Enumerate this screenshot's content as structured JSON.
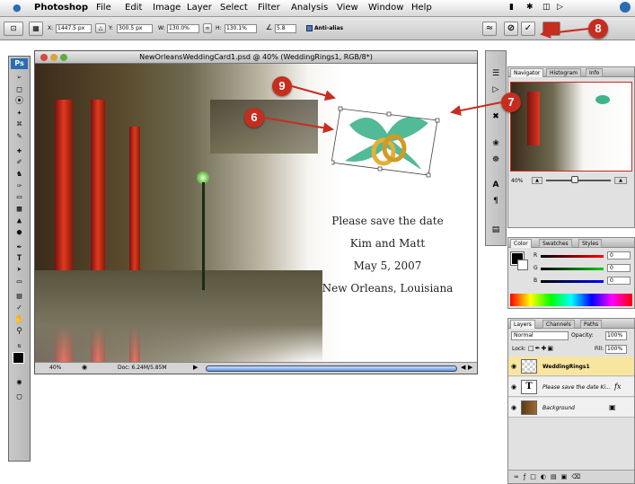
{
  "menubar": {
    "apple_icon": "apple-icon",
    "app": "Photoshop",
    "items": [
      "File",
      "Edit",
      "Image",
      "Layer",
      "Select",
      "Filter",
      "Analysis",
      "View",
      "Window",
      "Help"
    ]
  },
  "options": {
    "x_label": "X:",
    "x_value": "1447.5 px",
    "y_label": "Y:",
    "y_value": "300.5 px",
    "w_label": "W:",
    "w_value": "130.0%",
    "h_label": "H:",
    "h_value": "130.1%",
    "angle_label": "∠",
    "angle_value": "5.8",
    "antialias_label": "Anti-alias",
    "cancel_icon": "cancel-transform-icon",
    "commit_icon": "commit-check-icon"
  },
  "document": {
    "title": "NewOrleansWeddingCard1.psd @ 40% (WeddingRings1, RGB/8*)",
    "card_lines": [
      "Please save the date",
      "Kim and Matt",
      "May 5, 2007",
      "New Orleans, Louisiana"
    ],
    "zoom": "40%",
    "doc_size": "Doc: 6.24M/5.85M"
  },
  "toolbox": {
    "logo": "Ps"
  },
  "navigator": {
    "tabs": [
      "Navigator",
      "Histogram",
      "Info"
    ],
    "zoom": "40%"
  },
  "color_panel": {
    "tabs": [
      "Color",
      "Swatches",
      "Styles"
    ],
    "channels": [
      {
        "label": "R",
        "value": "0"
      },
      {
        "label": "G",
        "value": "0"
      },
      {
        "label": "B",
        "value": "0"
      }
    ]
  },
  "layers_panel": {
    "tabs": [
      "Layers",
      "Channels",
      "Paths"
    ],
    "blend_mode": "Normal",
    "opacity_label": "Opacity:",
    "opacity_value": "100%",
    "lock_label": "Lock:",
    "fill_label": "Fill:",
    "fill_value": "100%",
    "layers": [
      {
        "name": "WeddingRings1",
        "selected": true
      },
      {
        "name": "Please save the date Ki...",
        "selected": false
      },
      {
        "name": "Background",
        "selected": false
      }
    ]
  },
  "callouts": [
    "6",
    "7",
    "8",
    "9"
  ],
  "colors": {
    "callout": "#c62d1f",
    "ribbon": "#3fb38b",
    "ring": "#e2b03a",
    "selected_layer": "#f8e6a0"
  }
}
